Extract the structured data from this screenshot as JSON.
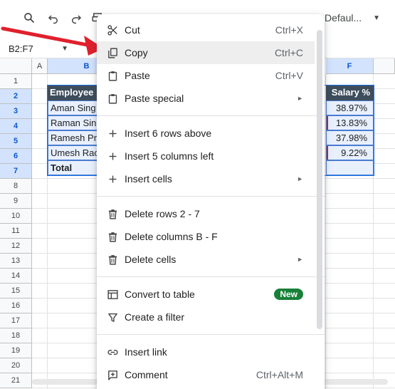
{
  "toolbar": {
    "icons": [
      "search-icon",
      "undo-icon",
      "redo-icon",
      "print-icon"
    ],
    "font": "Defaul...",
    "font_caret": "▼"
  },
  "namebox": {
    "value": "B2:F7",
    "caret": "▼"
  },
  "columns": [
    {
      "label": "A",
      "selected": false
    },
    {
      "label": "B",
      "selected": true
    },
    {
      "label": "F",
      "selected": true
    }
  ],
  "rows": [
    "1",
    "2",
    "3",
    "4",
    "5",
    "6",
    "7",
    "8",
    "9",
    "10",
    "11",
    "12",
    "13",
    "14",
    "15",
    "16",
    "17",
    "18",
    "19",
    "20",
    "21"
  ],
  "table": {
    "header_b": "Employee",
    "header_f": "Salary %",
    "names": [
      "Aman Sing",
      "Raman Sin",
      "Ramesh Pr",
      "Umesh Rac"
    ],
    "percents": [
      "38.97%",
      "13.83%",
      "37.98%",
      "9.22%"
    ],
    "total": "Total"
  },
  "menu": {
    "cut": {
      "label": "Cut",
      "shortcut": "Ctrl+X"
    },
    "copy": {
      "label": "Copy",
      "shortcut": "Ctrl+C"
    },
    "paste": {
      "label": "Paste",
      "shortcut": "Ctrl+V"
    },
    "paste_special": {
      "label": "Paste special",
      "arrow": "►"
    },
    "insert_rows": {
      "label": "Insert 6 rows above"
    },
    "insert_cols": {
      "label": "Insert 5 columns left"
    },
    "insert_cells": {
      "label": "Insert cells",
      "arrow": "►"
    },
    "delete_rows": {
      "label": "Delete rows 2 - 7"
    },
    "delete_cols": {
      "label": "Delete columns B - F"
    },
    "delete_cells": {
      "label": "Delete cells",
      "arrow": "►"
    },
    "convert_table": {
      "label": "Convert to table",
      "badge": "New"
    },
    "create_filter": {
      "label": "Create a filter"
    },
    "insert_link": {
      "label": "Insert link"
    },
    "comment": {
      "label": "Comment",
      "shortcut": "Ctrl+Alt+M"
    }
  },
  "colors": {
    "accent": "#1a73e8",
    "header_bg": "#3d4d5c",
    "badge": "#188038",
    "arrow": "#e0202c"
  }
}
